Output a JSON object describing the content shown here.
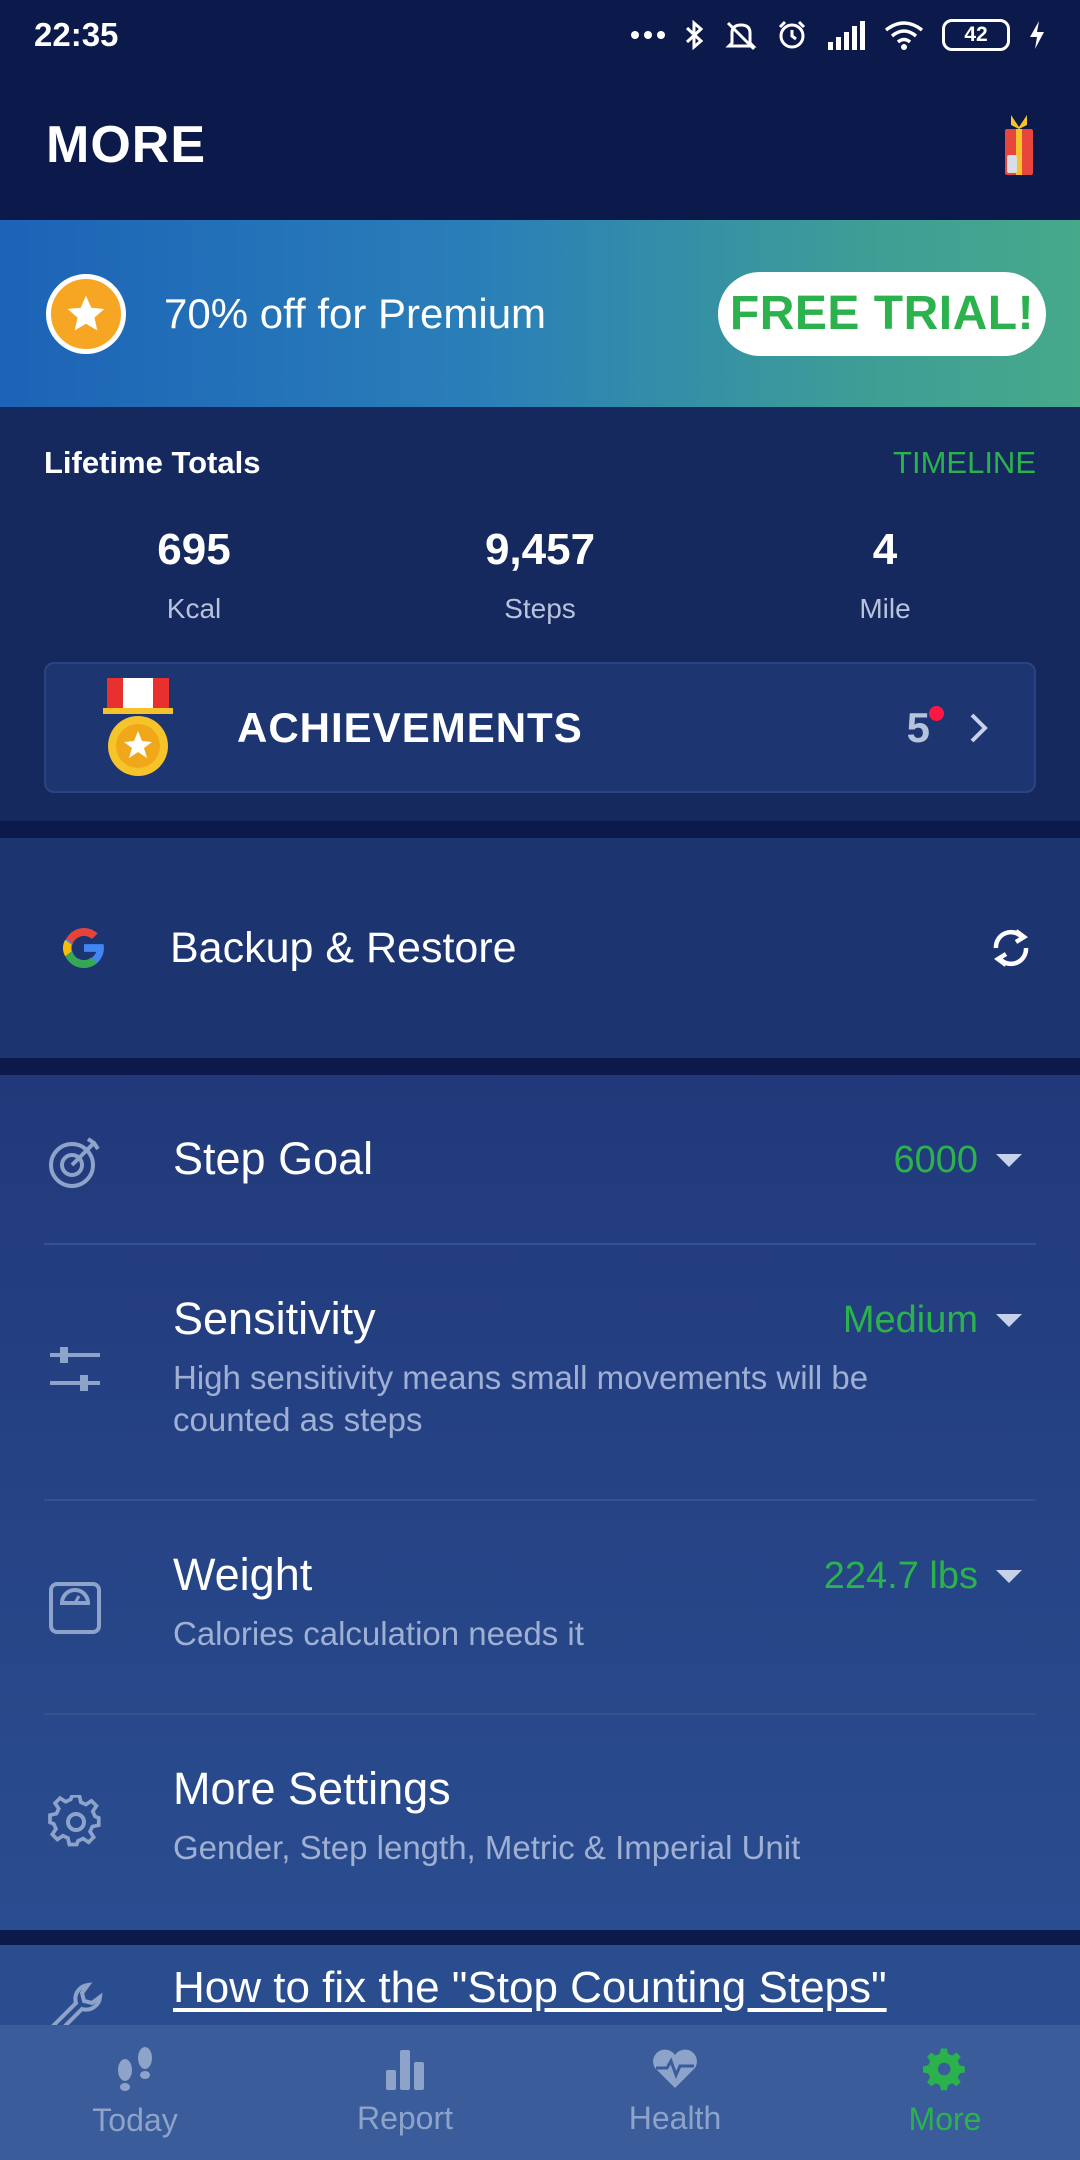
{
  "status_bar": {
    "time": "22:35",
    "battery": "42",
    "icons": [
      "more-dots-icon",
      "bluetooth-icon",
      "bell-off-icon",
      "alarm-icon",
      "signal-icon",
      "wifi-icon",
      "battery-icon",
      "charging-icon"
    ]
  },
  "header": {
    "title": "MORE",
    "gift_icon": "gift-icon"
  },
  "promo": {
    "text": "70% off for Premium",
    "button": "FREE TRIAL!"
  },
  "totals": {
    "label": "Lifetime Totals",
    "timeline": "TIMELINE",
    "stats": [
      {
        "value": "695",
        "unit": "Kcal"
      },
      {
        "value": "9,457",
        "unit": "Steps"
      },
      {
        "value": "4",
        "unit": "Mile"
      }
    ]
  },
  "achievements": {
    "label": "ACHIEVEMENTS",
    "count": "5"
  },
  "backup": {
    "label": "Backup & Restore"
  },
  "settings": {
    "step_goal": {
      "title": "Step Goal",
      "value": "6000"
    },
    "sensitivity": {
      "title": "Sensitivity",
      "value": "Medium",
      "subtitle": "High sensitivity means small movements will be counted as steps"
    },
    "weight": {
      "title": "Weight",
      "value": "224.7 lbs",
      "subtitle": "Calories calculation needs it"
    },
    "more_settings": {
      "title": "More Settings",
      "subtitle": "Gender, Step length, Metric & Imperial Unit"
    }
  },
  "howto": {
    "link": "How to fix the \"Stop Counting Steps\""
  },
  "tabs": [
    {
      "label": "Today",
      "icon": "footsteps-icon"
    },
    {
      "label": "Report",
      "icon": "bar-chart-icon"
    },
    {
      "label": "Health",
      "icon": "heart-pulse-icon"
    },
    {
      "label": "More",
      "icon": "gear-icon",
      "active": true
    }
  ],
  "colors": {
    "accent": "#2bb24c",
    "background": "#0b1a4a",
    "badge": "#ff1744"
  }
}
